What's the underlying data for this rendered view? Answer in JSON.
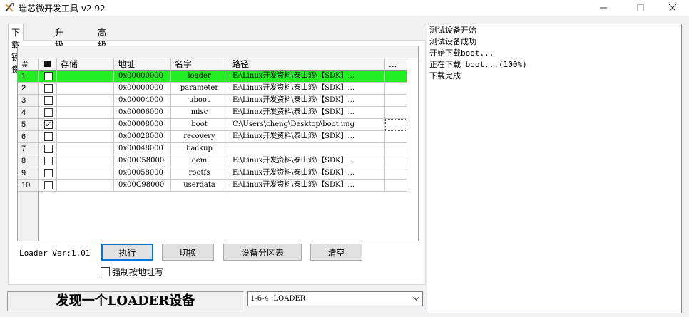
{
  "window": {
    "title": "瑞芯微开发工具 v2.92"
  },
  "tabs": [
    {
      "label": "下载镜像",
      "active": true
    },
    {
      "label": "升级固件",
      "active": false
    },
    {
      "label": "高级功能",
      "active": false
    }
  ],
  "table": {
    "headers": {
      "num": "#",
      "store": "存储",
      "addr": "地址",
      "name": "名字",
      "path": "路径",
      "more": "..."
    },
    "rows": [
      {
        "num": "1",
        "checked": false,
        "addr": "0x00000000",
        "name": "loader",
        "path": "E:\\Linux开发资料\\泰山派\\【SDK】...",
        "more": ""
      },
      {
        "num": "2",
        "checked": false,
        "addr": "0x00000000",
        "name": "parameter",
        "path": "E:\\Linux开发资料\\泰山派\\【SDK】...",
        "more": ""
      },
      {
        "num": "3",
        "checked": false,
        "addr": "0x00004000",
        "name": "uboot",
        "path": "E:\\Linux开发资料\\泰山派\\【SDK】...",
        "more": ""
      },
      {
        "num": "4",
        "checked": false,
        "addr": "0x00006000",
        "name": "misc",
        "path": "E:\\Linux开发资料\\泰山派\\【SDK】...",
        "more": ""
      },
      {
        "num": "5",
        "checked": true,
        "addr": "0x00008000",
        "name": "boot",
        "path": "C:\\Users\\cheng\\Desktop\\boot.img",
        "more": ""
      },
      {
        "num": "6",
        "checked": false,
        "addr": "0x00028000",
        "name": "recovery",
        "path": "E:\\Linux开发资料\\泰山派\\【SDK】...",
        "more": ""
      },
      {
        "num": "7",
        "checked": false,
        "addr": "0x00048000",
        "name": "backup",
        "path": "",
        "more": ""
      },
      {
        "num": "8",
        "checked": false,
        "addr": "0x00C58000",
        "name": "oem",
        "path": "E:\\Linux开发资料\\泰山派\\【SDK】...",
        "more": ""
      },
      {
        "num": "9",
        "checked": false,
        "addr": "0x00058000",
        "name": "rootfs",
        "path": "E:\\Linux开发资料\\泰山派\\【SDK】...",
        "more": ""
      },
      {
        "num": "10",
        "checked": false,
        "addr": "0x00C98000",
        "name": "userdata",
        "path": "E:\\Linux开发资料\\泰山派\\【SDK】...",
        "more": ""
      }
    ],
    "selected_row": "1",
    "selected_color": "#22ee22"
  },
  "loader_version": "Loader Ver:1.01",
  "buttons": {
    "run": "执行",
    "switch": "切换",
    "partition_table": "设备分区表",
    "clear": "清空"
  },
  "force_by_address": {
    "label": "强制按地址写",
    "checked": false
  },
  "status": "发现一个LOADER设备",
  "device_select": {
    "value": "1-6-4 :LOADER"
  },
  "log": [
    "测试设备开始",
    "测试设备成功",
    "开始下载boot...",
    "正在下载 boot...(100%)",
    "下载完成"
  ],
  "icons": {
    "app": "rockchip-tool-icon",
    "minimize": "minimize-icon",
    "maximize": "maximize-icon",
    "close": "close-icon"
  }
}
